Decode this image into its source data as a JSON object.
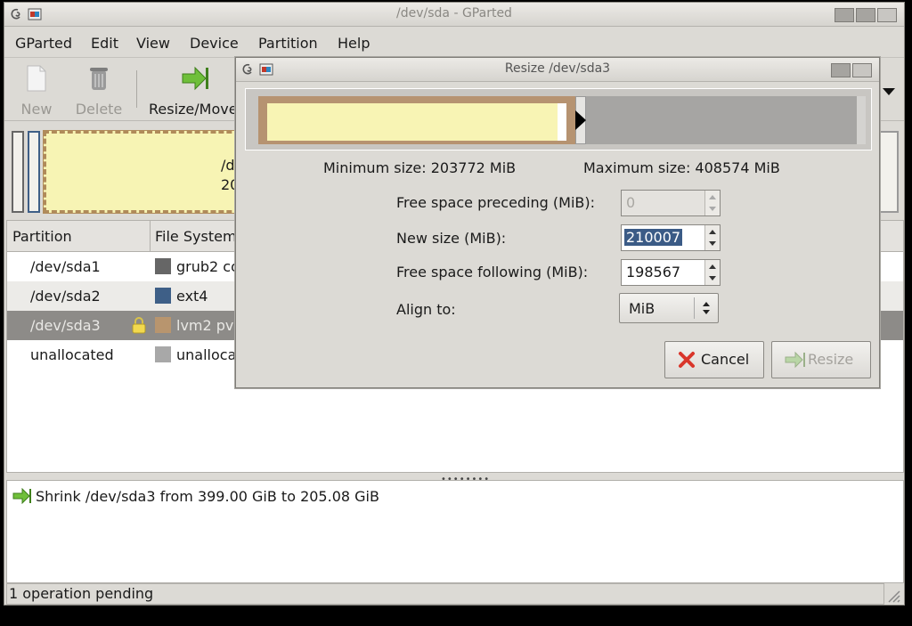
{
  "main_window": {
    "title": "/dev/sda - GParted",
    "menu": [
      "GParted",
      "Edit",
      "View",
      "Device",
      "Partition",
      "Help"
    ],
    "toolbar": {
      "new": "New",
      "delete": "Delete",
      "resize_move": "Resize/Move"
    },
    "disk_graph": {
      "label_line1": "/d",
      "label_line2": "20"
    },
    "table": {
      "headers": [
        "Partition",
        "File System"
      ],
      "rows": [
        {
          "partition": "/dev/sda1",
          "fs": "grub2 co",
          "color": "#666666"
        },
        {
          "partition": "/dev/sda2",
          "fs": "ext4",
          "color": "#3e5f87"
        },
        {
          "partition": "/dev/sda3",
          "fs": "lvm2 pv",
          "color": "#b8956e",
          "locked": true
        },
        {
          "partition": "unallocated",
          "fs": "unalloca",
          "color": "#a8a8a8"
        }
      ]
    },
    "log": {
      "operation": "Shrink /dev/sda3 from 399.00 GiB to 205.08 GiB"
    },
    "status": "1 operation pending"
  },
  "dialog": {
    "title": "Resize /dev/sda3",
    "min_size": "Minimum size: 203772 MiB",
    "max_size": "Maximum size: 408574 MiB",
    "fields": {
      "preceding_label": "Free space preceding (MiB):",
      "preceding_value": "0",
      "new_size_label": "New size (MiB):",
      "new_size_value": "210007",
      "following_label": "Free space following (MiB):",
      "following_value": "198567",
      "align_label": "Align to:",
      "align_value": "MiB"
    },
    "buttons": {
      "cancel": "Cancel",
      "resize": "Resize"
    }
  }
}
